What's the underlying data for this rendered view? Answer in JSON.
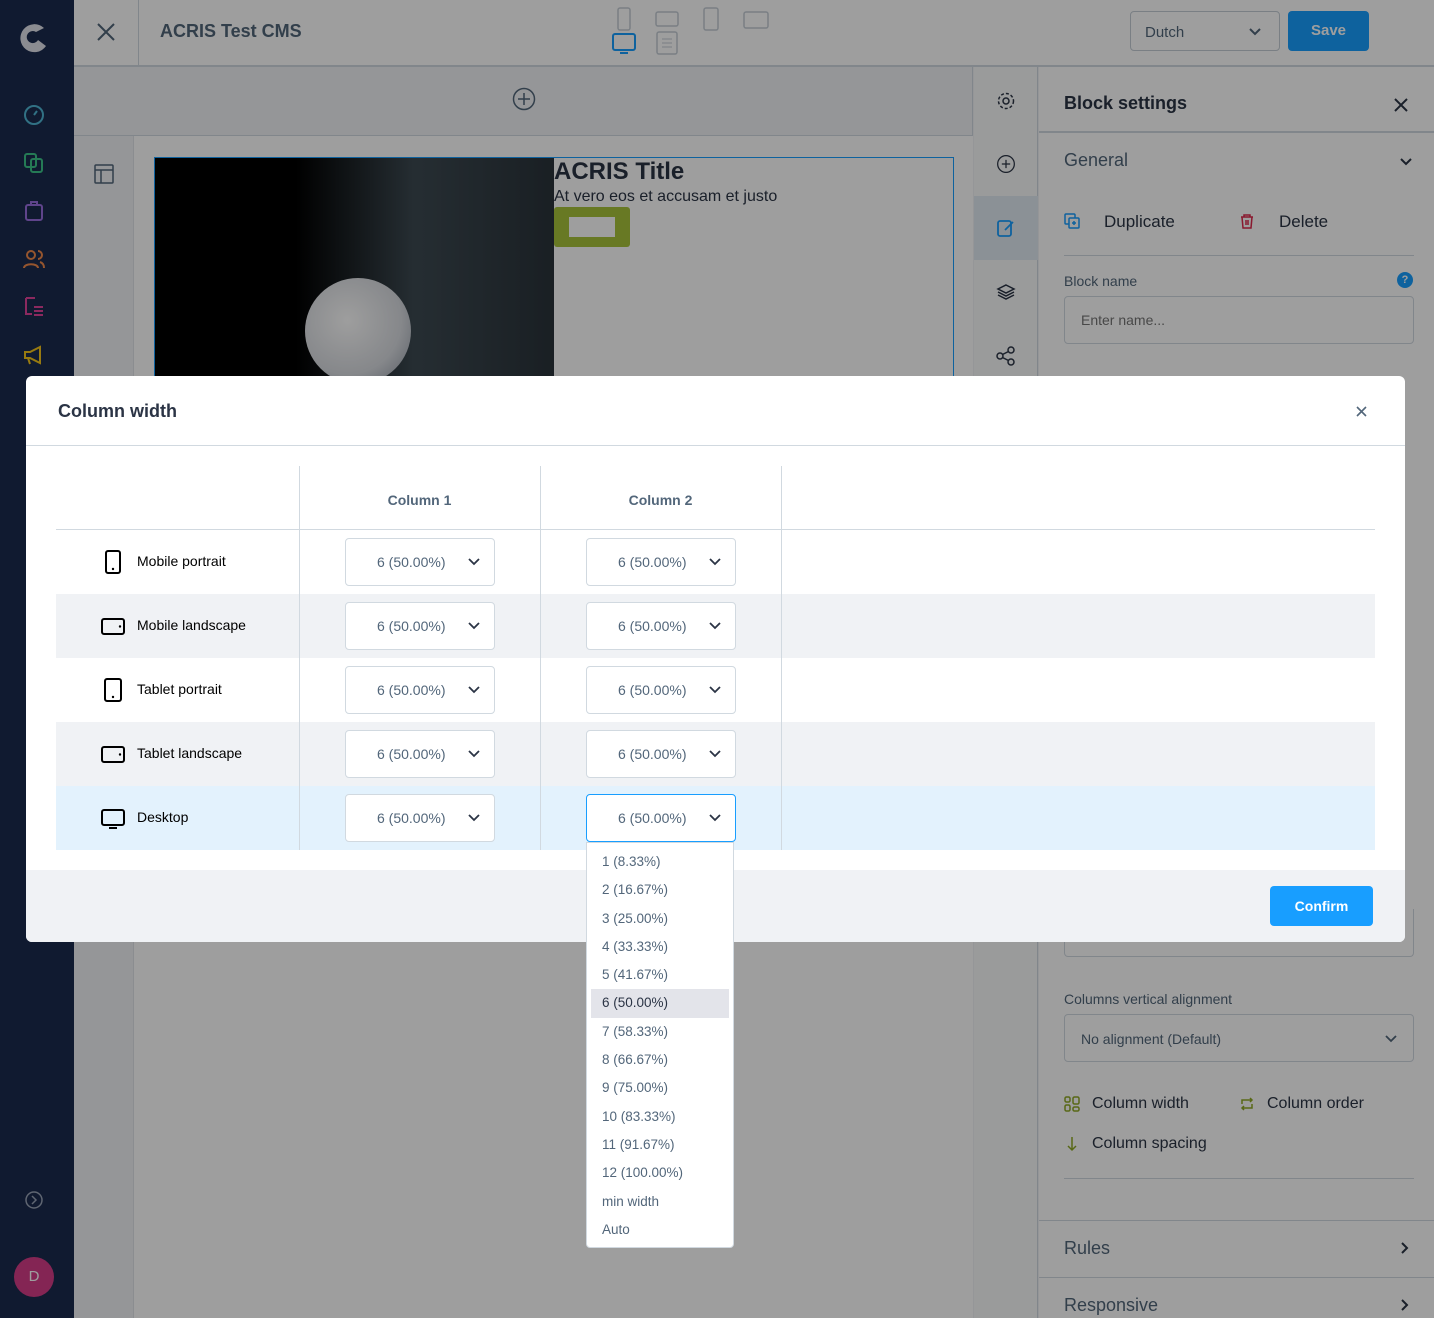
{
  "app": {
    "title": "ACRIS Test CMS",
    "language": "Dutch",
    "save_label": "Save",
    "avatar_initial": "D"
  },
  "sidebar": {
    "icons": [
      "dashboard-icon",
      "catalog-icon",
      "orders-icon",
      "customers-icon",
      "content-icon",
      "marketing-icon"
    ]
  },
  "canvas": {
    "block_title": "ACRIS Title",
    "block_text": "At vero eos et accusam et justo"
  },
  "panel": {
    "title": "Block settings",
    "general": "General",
    "duplicate": "Duplicate",
    "delete": "Delete",
    "block_name_label": "Block name",
    "block_name_placeholder": "Enter name...",
    "valign_label": "Columns vertical alignment",
    "valign_value": "No alignment (Default)",
    "column_width": "Column width",
    "column_order": "Column order",
    "column_spacing": "Column spacing",
    "rules": "Rules",
    "responsive": "Responsive"
  },
  "modal": {
    "title": "Column width",
    "columns": [
      "Column 1",
      "Column 2"
    ],
    "rows": [
      {
        "device": "Mobile portrait",
        "values": [
          "6 (50.00%)",
          "6 (50.00%)"
        ]
      },
      {
        "device": "Mobile landscape",
        "values": [
          "6 (50.00%)",
          "6 (50.00%)"
        ]
      },
      {
        "device": "Tablet portrait",
        "values": [
          "6 (50.00%)",
          "6 (50.00%)"
        ]
      },
      {
        "device": "Tablet landscape",
        "values": [
          "6 (50.00%)",
          "6 (50.00%)"
        ]
      },
      {
        "device": "Desktop",
        "values": [
          "6 (50.00%)",
          "6 (50.00%)"
        ]
      }
    ],
    "confirm_label": "Confirm",
    "dropdown_options": [
      "1 (8.33%)",
      "2 (16.67%)",
      "3 (25.00%)",
      "4 (33.33%)",
      "5 (41.67%)",
      "6 (50.00%)",
      "7 (58.33%)",
      "8 (66.67%)",
      "9 (75.00%)",
      "10 (83.33%)",
      "11 (91.67%)",
      "12 (100.00%)",
      "min width",
      "Auto"
    ],
    "dropdown_selected": "6 (50.00%)"
  },
  "colors": {
    "accent": "#189eff",
    "sidebar": "#1b2a4e",
    "green": "#8fa824",
    "delete": "#de294c"
  }
}
